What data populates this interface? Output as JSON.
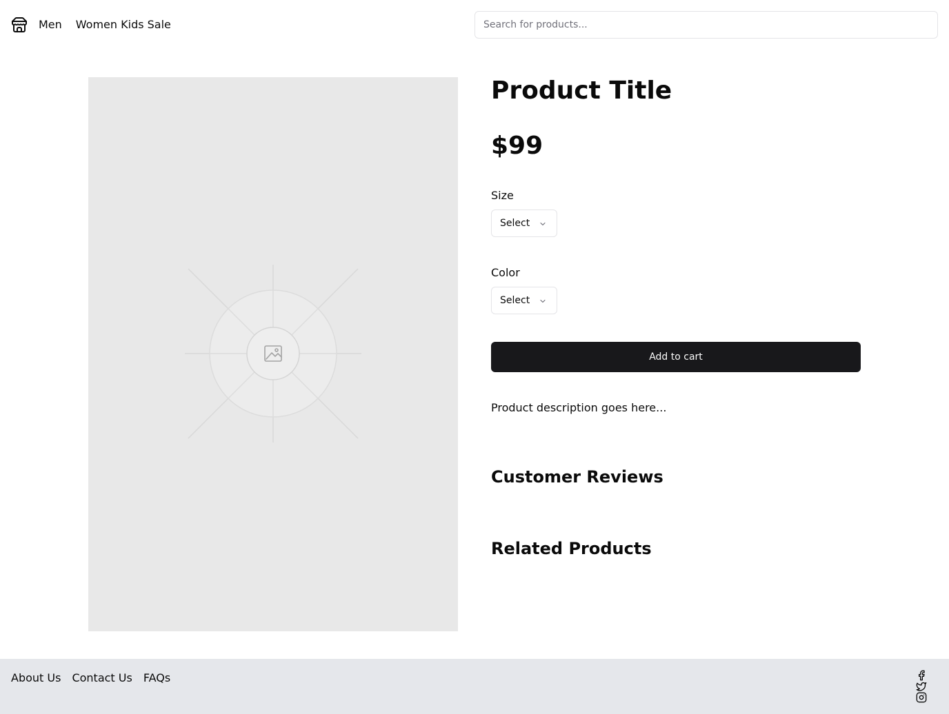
{
  "header": {
    "logo_icon": "store-icon",
    "nav": [
      {
        "label": "Men"
      },
      {
        "label": "Women Kids Sale"
      }
    ],
    "search": {
      "placeholder": "Search for products...",
      "value": ""
    }
  },
  "product": {
    "image_icon": "image-placeholder-icon",
    "title": "Product Title",
    "price": "$99",
    "size": {
      "label": "Size",
      "selected": "Select"
    },
    "color": {
      "label": "Color",
      "selected": "Select"
    },
    "add_to_cart_label": "Add to cart",
    "description": "Product description goes here...",
    "reviews_heading": "Customer Reviews",
    "related_heading": "Related Products"
  },
  "footer": {
    "links": [
      {
        "label": "About Us"
      },
      {
        "label": "Contact Us"
      },
      {
        "label": "FAQs"
      }
    ],
    "social": [
      "facebook-icon",
      "twitter-icon",
      "instagram-icon"
    ]
  },
  "colors": {
    "primary_button": "#18181b",
    "footer_bg": "#e5e7eb",
    "image_bg": "#e8e8e8"
  }
}
